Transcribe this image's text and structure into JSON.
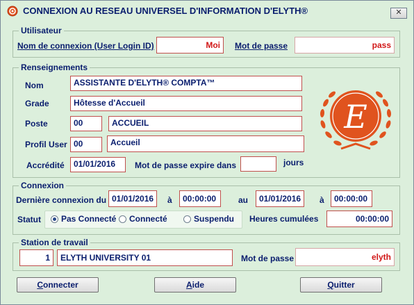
{
  "window": {
    "title": "CONNEXION AU RESEAU UNIVERSEL D'INFORMATION D'ELYTH®",
    "close_label": "✕"
  },
  "utilisateur": {
    "legend": "Utilisateur",
    "login_label": "Nom de connexion (User Login ID)",
    "login_value": "Moi",
    "password_label": "Mot de passe",
    "password_value": "pass"
  },
  "renseignements": {
    "legend": "Renseignements",
    "nom_label": "Nom",
    "nom_value": "ASSISTANTE D'ELYTH® COMPTA™",
    "grade_label": "Grade",
    "grade_value": "Hôtesse d'Accueil",
    "poste_label": "Poste",
    "poste_code": "00",
    "poste_value": "ACCUEIL",
    "profil_label": "Profil User",
    "profil_code": "00",
    "profil_value": "Accueil",
    "accredite_label": "Accrédité",
    "accredite_value": "01/01/2016",
    "expire_label": "Mot de passe expire dans",
    "expire_value": "",
    "jours_label": "jours",
    "logo_letter": "E"
  },
  "connexion": {
    "legend": "Connexion",
    "derniere_label": "Dernière connexion du",
    "date_from": "01/01/2016",
    "a_label_1": "à",
    "time_from": "00:00:00",
    "au_label": "au",
    "date_to": "01/01/2016",
    "a_label_2": "à",
    "time_to": "00:00:00",
    "statut_label": "Statut",
    "options": [
      "Pas Connecté",
      "Connecté",
      "Suspendu"
    ],
    "selected_option": "Pas Connecté",
    "heures_label": "Heures cumulées",
    "heures_value": "00:00:00"
  },
  "station": {
    "legend": "Station de travail",
    "station_number": "1",
    "station_name": "ELYTH UNIVERSITY 01",
    "password_label": "Mot de passe",
    "password_value": "elyth"
  },
  "buttons": {
    "connecter_first": "C",
    "connecter_rest": "onnecter",
    "aide_first": "A",
    "aide_rest": "ide",
    "quitter_first": "Q",
    "quitter_rest": "uitter"
  },
  "colors": {
    "accent_text": "#0a1e6e",
    "value_red": "#d11818",
    "field_border": "#c0504d",
    "logo_orange": "#e0531e",
    "background": "#dcefdc"
  }
}
